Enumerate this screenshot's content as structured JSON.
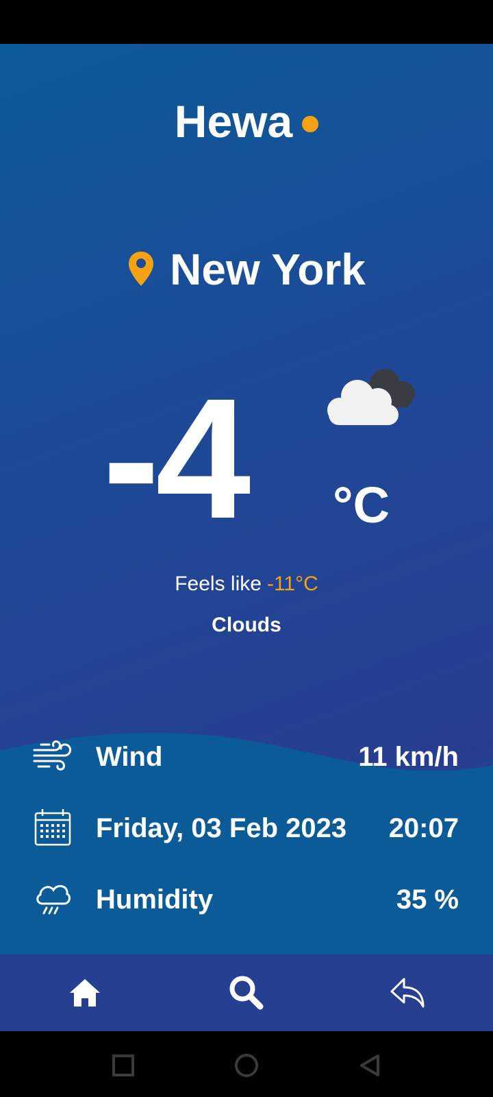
{
  "app": {
    "brand": "Hewa",
    "accent_color": "#f7a212"
  },
  "location": {
    "city": "New York",
    "icon": "location-pin-icon"
  },
  "current": {
    "temperature": "-4",
    "unit": "°C",
    "feels_like_label": "Feels like",
    "feels_like_value": "-11°C",
    "condition": "Clouds",
    "icon": "cloudy-icon"
  },
  "details": [
    {
      "icon": "wind-icon",
      "label": "Wind",
      "value": "11 km/h"
    },
    {
      "icon": "calendar-icon",
      "label": "Friday, 03 Feb 2023",
      "value": "20:07"
    },
    {
      "icon": "humidity-icon",
      "label": "Humidity",
      "value": "35 %"
    }
  ],
  "bottom_nav": [
    "home-icon",
    "search-icon",
    "back-icon"
  ],
  "system_nav": [
    "recents-icon",
    "home-circle-icon",
    "back-triangle-icon"
  ]
}
